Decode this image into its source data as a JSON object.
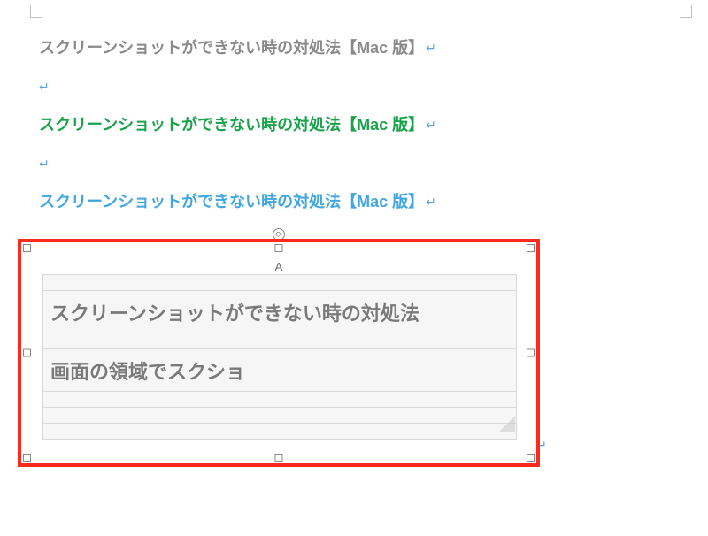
{
  "paragraphs": {
    "p1": "スクリーンショットができない時の対処法【Mac 版】",
    "p2": "スクリーンショットができない時の対処法【Mac 版】",
    "p3": "スクリーンショットができない時の対処法【Mac 版】"
  },
  "glyphs": {
    "pilcrow": "↵",
    "rotation": "⟳"
  },
  "embedded": {
    "column_letter": "A",
    "rows": [
      "スクリーンショットができない時の対処法",
      "画面の領域でスクショ"
    ]
  },
  "colors": {
    "gray": "#8a8a8a",
    "green": "#18a34a",
    "blue": "#42a7e0",
    "highlight_border": "#ff2a1e"
  }
}
